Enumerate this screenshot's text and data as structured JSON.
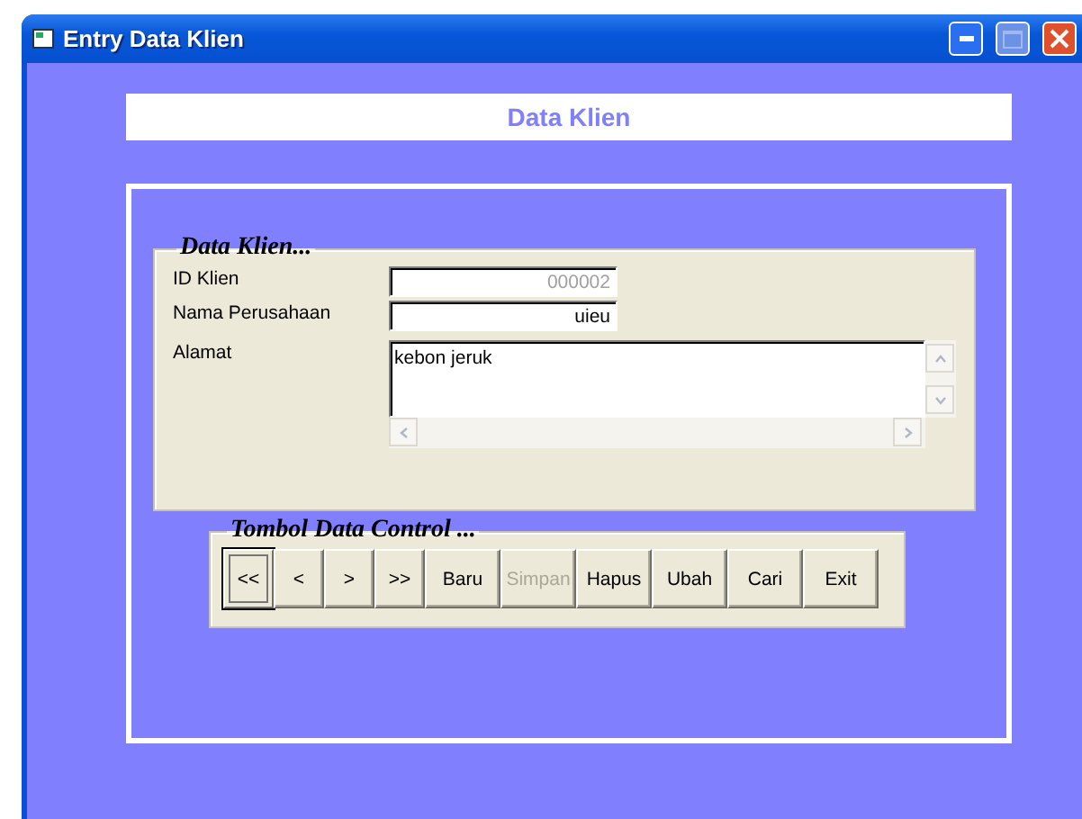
{
  "window": {
    "title": "Entry Data Klien"
  },
  "header": {
    "title": "Data Klien"
  },
  "client_group": {
    "title": "Data Klien...",
    "fields": [
      {
        "label": "ID Klien",
        "value": "000002",
        "disabled": true,
        "kind": "text"
      },
      {
        "label": "Nama Perusahaan",
        "value": "uieu",
        "disabled": false,
        "kind": "text"
      },
      {
        "label": "Alamat",
        "value": "kebon jeruk",
        "disabled": false,
        "kind": "memo"
      }
    ]
  },
  "control_group": {
    "title": "Tombol Data Control ...",
    "buttons": [
      {
        "label": "<<",
        "disabled": false,
        "focused": true,
        "kind": "nav"
      },
      {
        "label": "<",
        "disabled": false,
        "focused": false,
        "kind": "nav"
      },
      {
        "label": ">",
        "disabled": false,
        "focused": false,
        "kind": "nav"
      },
      {
        "label": ">>",
        "disabled": false,
        "focused": false,
        "kind": "nav"
      },
      {
        "label": "Baru",
        "disabled": false,
        "focused": false,
        "kind": "action"
      },
      {
        "label": "Simpan",
        "disabled": true,
        "focused": false,
        "kind": "action"
      },
      {
        "label": "Hapus",
        "disabled": false,
        "focused": false,
        "kind": "action"
      },
      {
        "label": "Ubah",
        "disabled": false,
        "focused": false,
        "kind": "action"
      },
      {
        "label": "Cari",
        "disabled": false,
        "focused": false,
        "kind": "action"
      },
      {
        "label": "Exit",
        "disabled": false,
        "focused": false,
        "kind": "action"
      }
    ]
  }
}
